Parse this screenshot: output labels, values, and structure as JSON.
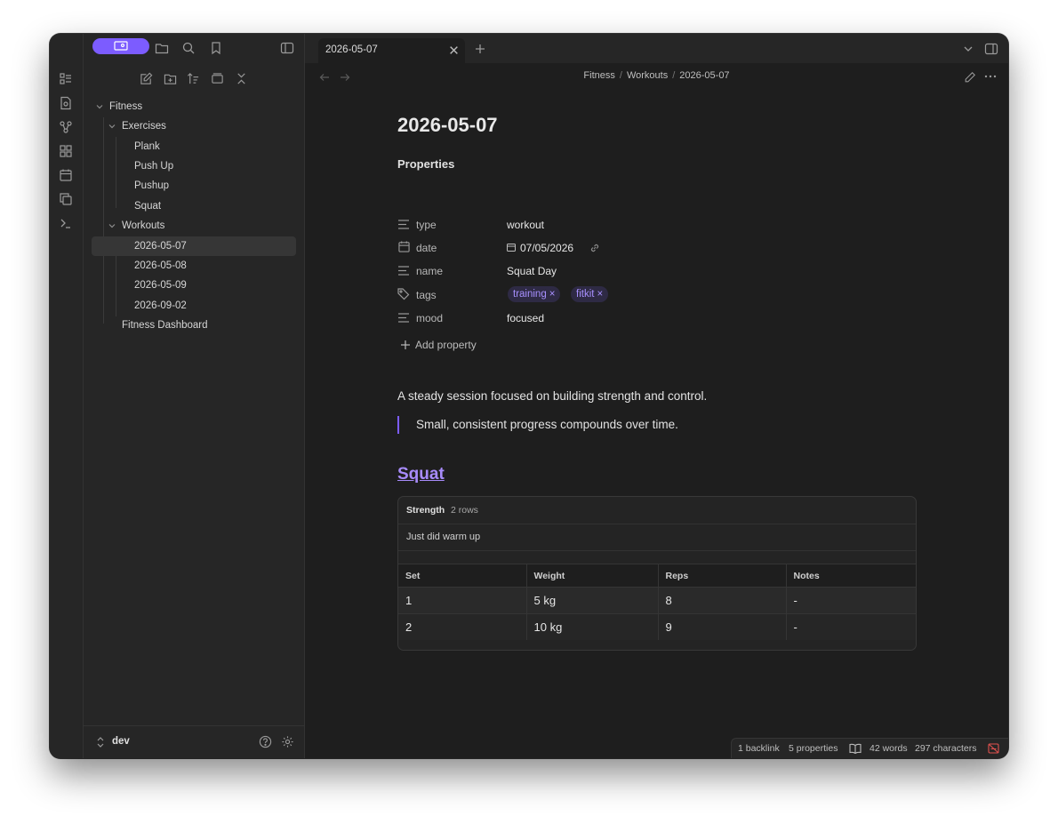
{
  "window": {
    "tab_title": "2026-05-07",
    "breadcrumb": [
      "Fitness",
      "Workouts",
      "2026-05-07"
    ]
  },
  "sidebar": {
    "tree": [
      {
        "label": "Fitness",
        "type": "folder"
      },
      {
        "label": "Exercises",
        "type": "folder"
      },
      {
        "label": "Plank",
        "type": "file"
      },
      {
        "label": "Push Up",
        "type": "file"
      },
      {
        "label": "Pushup",
        "type": "file"
      },
      {
        "label": "Squat",
        "type": "file"
      },
      {
        "label": "Workouts",
        "type": "folder"
      },
      {
        "label": "2026-05-07",
        "type": "file",
        "active": true
      },
      {
        "label": "2026-05-08",
        "type": "file"
      },
      {
        "label": "2026-05-09",
        "type": "file"
      },
      {
        "label": "2026-09-02",
        "type": "file"
      },
      {
        "label": "Fitness Dashboard",
        "type": "file"
      }
    ],
    "vault_name": "dev"
  },
  "note": {
    "title": "2026-05-07",
    "properties_heading": "Properties",
    "properties": [
      {
        "key": "type",
        "icon": "text-icon",
        "value": "workout"
      },
      {
        "key": "date",
        "icon": "calendar-icon",
        "value": "07/05/2026"
      },
      {
        "key": "name",
        "icon": "text-icon",
        "value": "Squat Day"
      },
      {
        "key": "tags",
        "icon": "tags-icon",
        "values": [
          "training",
          "fitkit"
        ]
      },
      {
        "key": "mood",
        "icon": "text-icon",
        "value": "focused"
      }
    ],
    "add_property": "Add property",
    "paragraph": "A steady session focused on building strength and control.",
    "quote": "Small, consistent progress compounds over time.",
    "heading": "Squat",
    "base": {
      "view_name": "Strength",
      "row_count": "2 rows",
      "note": "Just did warm up",
      "columns": [
        "Set",
        "Weight",
        "Reps",
        "Notes"
      ],
      "rows": [
        [
          "1",
          "5 kg",
          "8",
          "-"
        ],
        [
          "2",
          "10 kg",
          "9",
          "-"
        ]
      ]
    }
  },
  "status": {
    "backlinks": "1 backlink",
    "properties": "5 properties",
    "words": "42 words",
    "characters": "297 characters"
  },
  "colors": {
    "accent": "#7c5cff",
    "link": "#a78bfa",
    "background": "#1e1e1e",
    "panel": "#262626"
  }
}
